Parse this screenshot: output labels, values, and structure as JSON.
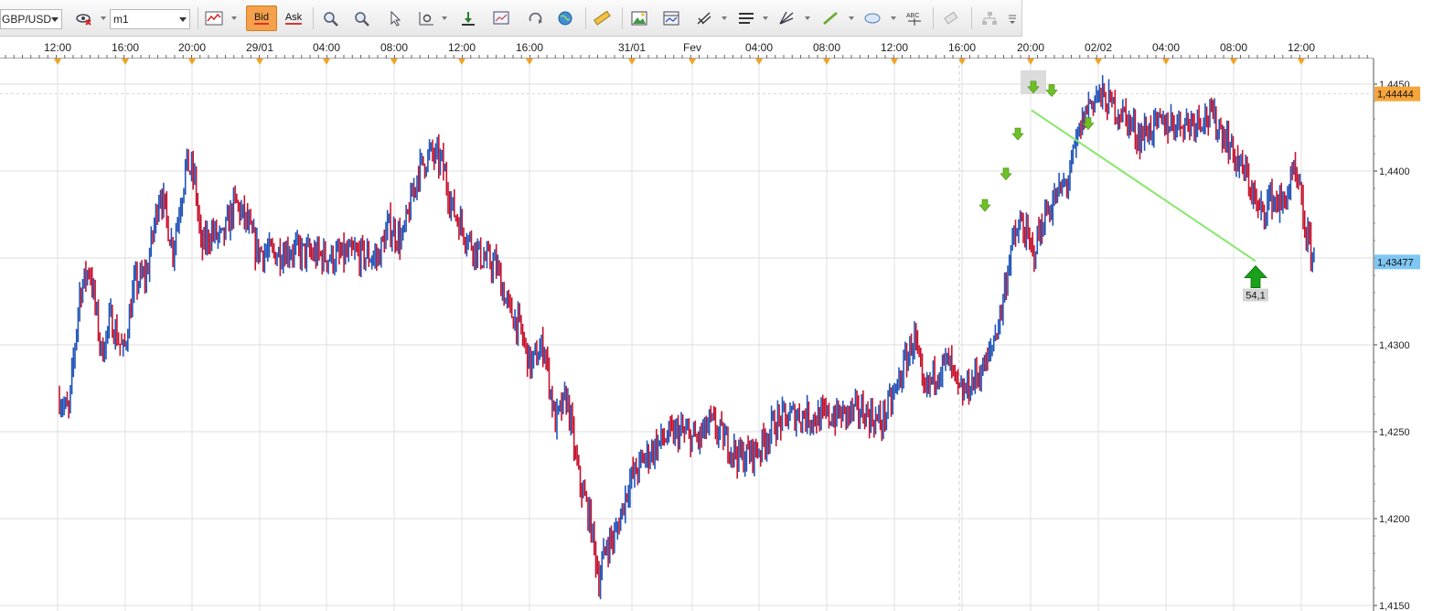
{
  "toolbar": {
    "symbol": "GBP/USD",
    "timeframe": "m1",
    "bid_label": "Bid",
    "ask_label": "Ask"
  },
  "chart_data": {
    "type": "candlestick",
    "symbol": "GBP/USD",
    "timeframe": "m1",
    "x_tick_labels": [
      "12:00",
      "16:00",
      "20:00",
      "29/01",
      "04:00",
      "08:00",
      "12:00",
      "16:00",
      "31/01",
      "Fev",
      "04:00",
      "08:00",
      "12:00",
      "16:00",
      "20:00",
      "02/02",
      "04:00",
      "08:00",
      "12:00"
    ],
    "y_tick_labels": [
      "1,4450",
      "1,4400",
      "1,4350",
      "1,4300",
      "1,4250",
      "1,4200",
      "1,4150"
    ],
    "ylim": [
      1.415,
      1.446
    ],
    "bid_price_label": "1,44444",
    "current_price_label": "1,43477",
    "measure_label": "54,1",
    "colors": {
      "up": "#2155b8",
      "down": "#c8122c",
      "trend_line": "#86e86a",
      "bid_tag": "#f6a53a",
      "price_tag": "#7fc7f2",
      "arrow_up": "#1aa01a",
      "arrow_down": "#6fbf25"
    },
    "price_path": [
      [
        0.0,
        1.427
      ],
      [
        0.01,
        1.426
      ],
      [
        0.022,
        1.433
      ],
      [
        0.033,
        1.4345
      ],
      [
        0.046,
        1.4295
      ],
      [
        0.056,
        1.4315
      ],
      [
        0.07,
        1.4295
      ],
      [
        0.082,
        1.4335
      ],
      [
        0.095,
        1.434
      ],
      [
        0.11,
        1.439
      ],
      [
        0.124,
        1.4355
      ],
      [
        0.139,
        1.4405
      ],
      [
        0.148,
        1.4395
      ],
      [
        0.155,
        1.4355
      ],
      [
        0.166,
        1.4365
      ],
      [
        0.178,
        1.436
      ],
      [
        0.192,
        1.4382
      ],
      [
        0.205,
        1.437
      ],
      [
        0.215,
        1.4355
      ],
      [
        0.232,
        1.4352
      ],
      [
        0.25,
        1.4355
      ],
      [
        0.275,
        1.4352
      ],
      [
        0.3,
        1.435
      ],
      [
        0.325,
        1.4352
      ],
      [
        0.348,
        1.435
      ],
      [
        0.36,
        1.4368
      ],
      [
        0.375,
        1.436
      ],
      [
        0.392,
        1.44
      ],
      [
        0.405,
        1.441
      ],
      [
        0.418,
        1.4405
      ],
      [
        0.43,
        1.4378
      ],
      [
        0.446,
        1.4362
      ],
      [
        0.462,
        1.435
      ],
      [
        0.478,
        1.4345
      ],
      [
        0.49,
        1.4322
      ],
      [
        0.503,
        1.431
      ],
      [
        0.515,
        1.4288
      ],
      [
        0.53,
        1.43
      ],
      [
        0.542,
        1.4255
      ],
      [
        0.555,
        1.427
      ],
      [
        0.567,
        1.4225
      ],
      [
        0.58,
        1.42
      ],
      [
        0.59,
        1.4165
      ],
      [
        0.598,
        1.4185
      ],
      [
        0.608,
        1.419
      ],
      [
        0.622,
        1.422
      ],
      [
        0.64,
        1.4235
      ],
      [
        0.658,
        1.4245
      ],
      [
        0.678,
        1.425
      ],
      [
        0.698,
        1.4245
      ],
      [
        0.712,
        1.4255
      ],
      [
        0.728,
        1.4245
      ],
      [
        0.745,
        1.4235
      ],
      [
        0.765,
        1.424
      ],
      [
        0.782,
        1.4255
      ],
      [
        0.805,
        1.426
      ],
      [
        0.832,
        1.4258
      ],
      [
        0.858,
        1.426
      ],
      [
        0.878,
        1.4262
      ],
      [
        0.898,
        1.4255
      ],
      [
        0.912,
        1.427
      ],
      [
        0.925,
        1.429
      ],
      [
        0.935,
        1.4305
      ],
      [
        0.945,
        1.427
      ],
      [
        0.958,
        1.4285
      ],
      [
        0.972,
        1.429
      ],
      [
        0.985,
        1.427
      ],
      [
        1.0,
        1.428
      ],
      [
        1.015,
        1.429
      ],
      [
        1.03,
        1.432
      ],
      [
        1.04,
        1.4355
      ],
      [
        1.052,
        1.437
      ],
      [
        1.064,
        1.4352
      ],
      [
        1.078,
        1.4375
      ],
      [
        1.09,
        1.4385
      ],
      [
        1.103,
        1.4395
      ],
      [
        1.115,
        1.4422
      ],
      [
        1.125,
        1.4438
      ],
      [
        1.135,
        1.4444
      ],
      [
        1.15,
        1.4438
      ],
      [
        1.165,
        1.4432
      ],
      [
        1.18,
        1.442
      ],
      [
        1.195,
        1.4425
      ],
      [
        1.215,
        1.4428
      ],
      [
        1.235,
        1.4428
      ],
      [
        1.25,
        1.4432
      ],
      [
        1.262,
        1.443
      ],
      [
        1.275,
        1.442
      ],
      [
        1.288,
        1.4405
      ],
      [
        1.3,
        1.4395
      ],
      [
        1.312,
        1.4375
      ],
      [
        1.325,
        1.4385
      ],
      [
        1.337,
        1.438
      ],
      [
        1.35,
        1.4398
      ],
      [
        1.357,
        1.4385
      ],
      [
        1.362,
        1.4365
      ],
      [
        1.368,
        1.4355
      ],
      [
        1.373,
        1.4348
      ]
    ]
  }
}
